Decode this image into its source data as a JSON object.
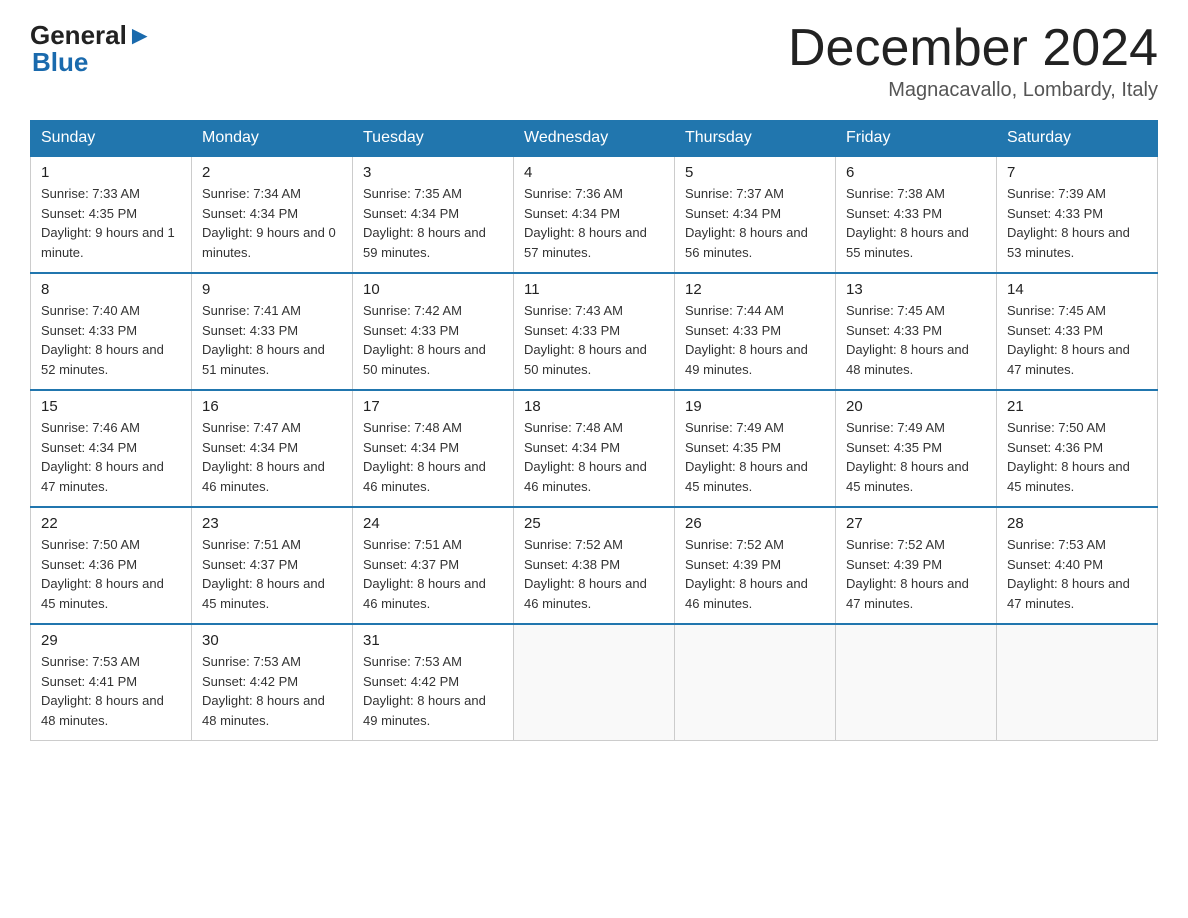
{
  "header": {
    "logo_general": "General",
    "logo_blue": "Blue",
    "month_title": "December 2024",
    "location": "Magnacavallo, Lombardy, Italy"
  },
  "weekdays": [
    "Sunday",
    "Monday",
    "Tuesday",
    "Wednesday",
    "Thursday",
    "Friday",
    "Saturday"
  ],
  "weeks": [
    [
      {
        "day": "1",
        "sunrise": "7:33 AM",
        "sunset": "4:35 PM",
        "daylight": "9 hours and 1 minute."
      },
      {
        "day": "2",
        "sunrise": "7:34 AM",
        "sunset": "4:34 PM",
        "daylight": "9 hours and 0 minutes."
      },
      {
        "day": "3",
        "sunrise": "7:35 AM",
        "sunset": "4:34 PM",
        "daylight": "8 hours and 59 minutes."
      },
      {
        "day": "4",
        "sunrise": "7:36 AM",
        "sunset": "4:34 PM",
        "daylight": "8 hours and 57 minutes."
      },
      {
        "day": "5",
        "sunrise": "7:37 AM",
        "sunset": "4:34 PM",
        "daylight": "8 hours and 56 minutes."
      },
      {
        "day": "6",
        "sunrise": "7:38 AM",
        "sunset": "4:33 PM",
        "daylight": "8 hours and 55 minutes."
      },
      {
        "day": "7",
        "sunrise": "7:39 AM",
        "sunset": "4:33 PM",
        "daylight": "8 hours and 53 minutes."
      }
    ],
    [
      {
        "day": "8",
        "sunrise": "7:40 AM",
        "sunset": "4:33 PM",
        "daylight": "8 hours and 52 minutes."
      },
      {
        "day": "9",
        "sunrise": "7:41 AM",
        "sunset": "4:33 PM",
        "daylight": "8 hours and 51 minutes."
      },
      {
        "day": "10",
        "sunrise": "7:42 AM",
        "sunset": "4:33 PM",
        "daylight": "8 hours and 50 minutes."
      },
      {
        "day": "11",
        "sunrise": "7:43 AM",
        "sunset": "4:33 PM",
        "daylight": "8 hours and 50 minutes."
      },
      {
        "day": "12",
        "sunrise": "7:44 AM",
        "sunset": "4:33 PM",
        "daylight": "8 hours and 49 minutes."
      },
      {
        "day": "13",
        "sunrise": "7:45 AM",
        "sunset": "4:33 PM",
        "daylight": "8 hours and 48 minutes."
      },
      {
        "day": "14",
        "sunrise": "7:45 AM",
        "sunset": "4:33 PM",
        "daylight": "8 hours and 47 minutes."
      }
    ],
    [
      {
        "day": "15",
        "sunrise": "7:46 AM",
        "sunset": "4:34 PM",
        "daylight": "8 hours and 47 minutes."
      },
      {
        "day": "16",
        "sunrise": "7:47 AM",
        "sunset": "4:34 PM",
        "daylight": "8 hours and 46 minutes."
      },
      {
        "day": "17",
        "sunrise": "7:48 AM",
        "sunset": "4:34 PM",
        "daylight": "8 hours and 46 minutes."
      },
      {
        "day": "18",
        "sunrise": "7:48 AM",
        "sunset": "4:34 PM",
        "daylight": "8 hours and 46 minutes."
      },
      {
        "day": "19",
        "sunrise": "7:49 AM",
        "sunset": "4:35 PM",
        "daylight": "8 hours and 45 minutes."
      },
      {
        "day": "20",
        "sunrise": "7:49 AM",
        "sunset": "4:35 PM",
        "daylight": "8 hours and 45 minutes."
      },
      {
        "day": "21",
        "sunrise": "7:50 AM",
        "sunset": "4:36 PM",
        "daylight": "8 hours and 45 minutes."
      }
    ],
    [
      {
        "day": "22",
        "sunrise": "7:50 AM",
        "sunset": "4:36 PM",
        "daylight": "8 hours and 45 minutes."
      },
      {
        "day": "23",
        "sunrise": "7:51 AM",
        "sunset": "4:37 PM",
        "daylight": "8 hours and 45 minutes."
      },
      {
        "day": "24",
        "sunrise": "7:51 AM",
        "sunset": "4:37 PM",
        "daylight": "8 hours and 46 minutes."
      },
      {
        "day": "25",
        "sunrise": "7:52 AM",
        "sunset": "4:38 PM",
        "daylight": "8 hours and 46 minutes."
      },
      {
        "day": "26",
        "sunrise": "7:52 AM",
        "sunset": "4:39 PM",
        "daylight": "8 hours and 46 minutes."
      },
      {
        "day": "27",
        "sunrise": "7:52 AM",
        "sunset": "4:39 PM",
        "daylight": "8 hours and 47 minutes."
      },
      {
        "day": "28",
        "sunrise": "7:53 AM",
        "sunset": "4:40 PM",
        "daylight": "8 hours and 47 minutes."
      }
    ],
    [
      {
        "day": "29",
        "sunrise": "7:53 AM",
        "sunset": "4:41 PM",
        "daylight": "8 hours and 48 minutes."
      },
      {
        "day": "30",
        "sunrise": "7:53 AM",
        "sunset": "4:42 PM",
        "daylight": "8 hours and 48 minutes."
      },
      {
        "day": "31",
        "sunrise": "7:53 AM",
        "sunset": "4:42 PM",
        "daylight": "8 hours and 49 minutes."
      },
      null,
      null,
      null,
      null
    ]
  ],
  "labels": {
    "sunrise": "Sunrise:",
    "sunset": "Sunset:",
    "daylight": "Daylight:"
  }
}
